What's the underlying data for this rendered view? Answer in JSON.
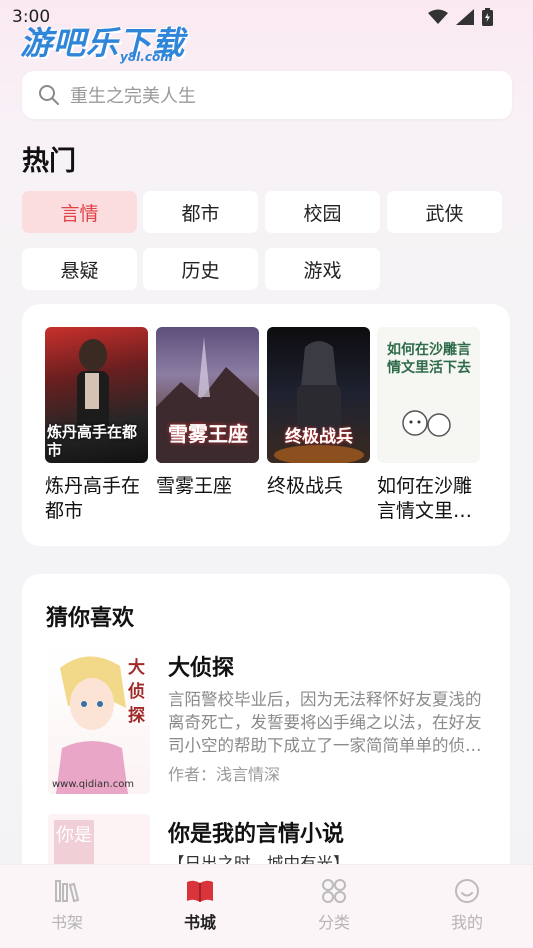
{
  "status_bar": {
    "time": "3:00"
  },
  "watermark": {
    "main": "游吧乐下载",
    "sub": "y8l.com"
  },
  "search": {
    "placeholder": "重生之完美人生"
  },
  "hot": {
    "title": "热门",
    "categories": [
      "言情",
      "都市",
      "校园",
      "武侠",
      "悬疑",
      "历史",
      "游戏"
    ],
    "active_category": "言情"
  },
  "featured_books": [
    {
      "title": "炼丹高手在都市",
      "cover_text": "炼丹高手在都市"
    },
    {
      "title": "雪雾王座",
      "cover_text": "雪雾王座"
    },
    {
      "title": "终极战兵",
      "cover_text": "终极战兵"
    },
    {
      "title": "如何在沙雕言情文里…",
      "cover_text": "如何在沙雕言情文里活下去"
    }
  ],
  "guess": {
    "title": "猜你喜欢",
    "items": [
      {
        "title": "大侦探",
        "description": "言陌警校毕业后，因为无法释怀好友夏浅的离奇死亡，发誓要将凶手绳之以法，在好友司小空的帮助下成立了一家简简单单的侦…",
        "author": "作者：浅言情深",
        "cover_text": "大侦探",
        "cover_caption": "www.qidian.com"
      },
      {
        "title": "你是我的言情小说",
        "description": "【日出之时，城中有光】",
        "cover_text": "你是"
      }
    ]
  },
  "tab_bar": {
    "tabs": [
      {
        "label": "书架",
        "icon": "bookshelf-icon"
      },
      {
        "label": "书城",
        "icon": "book-open-icon"
      },
      {
        "label": "分类",
        "icon": "category-grid-icon"
      },
      {
        "label": "我的",
        "icon": "smile-profile-icon"
      }
    ],
    "active": "书城"
  },
  "colors": {
    "accent": "#e0424a",
    "chip_active_bg": "#fbdcdf"
  }
}
